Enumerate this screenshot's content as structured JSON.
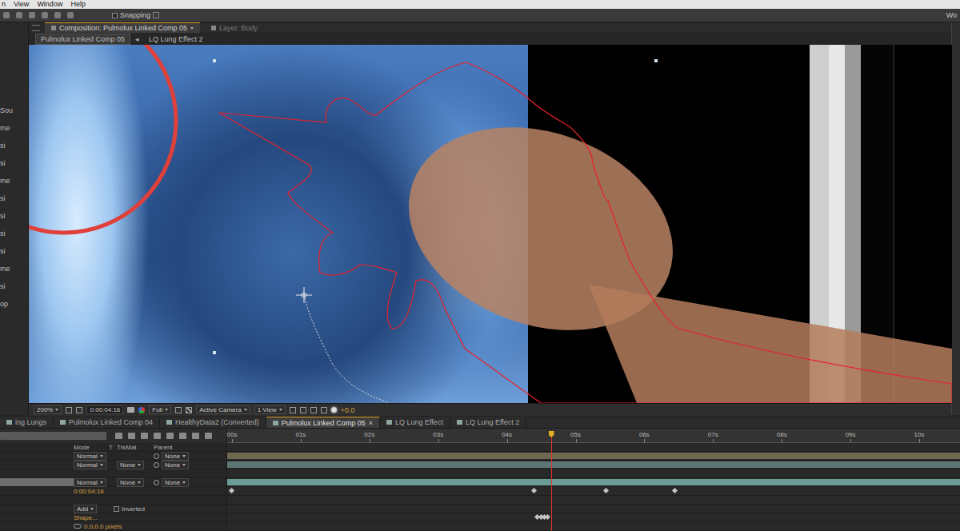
{
  "menu": [
    {
      "label": "n"
    },
    {
      "label": "View"
    },
    {
      "label": "Window"
    },
    {
      "label": "Help"
    }
  ],
  "toolbar": {
    "snapping": {
      "label": "Snapping",
      "checked": false
    },
    "workspace": "Wo"
  },
  "left_panel": {
    "items": [
      "Sou",
      "me",
      "si",
      "si",
      "me",
      "si",
      "si",
      "si",
      "si",
      "me",
      "si",
      "op"
    ]
  },
  "composition_panel": {
    "tabs": [
      {
        "label": "Composition: Pulmolux Linked Comp 05",
        "selected": true
      },
      {
        "label": "Layer: Body",
        "selected": false
      }
    ],
    "breadcrumbs": [
      {
        "label": "Pulmolux Linked Comp 05",
        "selected": true
      },
      {
        "label": "LQ Lung Effect 2",
        "selected": false
      }
    ],
    "separator": "◂"
  },
  "viewer_controls": {
    "zoom": "200%",
    "time": "0:00:04:16",
    "resolution": "Full",
    "camera": "Active Camera",
    "views": "1 View",
    "exposure": "+0.0"
  },
  "timeline": {
    "tabs": [
      {
        "label": "ing Lungs",
        "selected": false
      },
      {
        "label": "Pulmolux Linked Comp 04",
        "selected": false
      },
      {
        "label": "HealthyData2 (Converted)",
        "selected": false
      },
      {
        "label": "Pulmolux Linked Comp 05",
        "selected": true
      },
      {
        "label": "LQ Lung Effect",
        "selected": false
      },
      {
        "label": "LQ Lung Effect 2",
        "selected": false
      }
    ],
    "close": "×",
    "ruler": {
      "labels": [
        "00s",
        "01s",
        "02s",
        "03s",
        "04s",
        "05s",
        "06s",
        "07s",
        "08s",
        "09s",
        "10s"
      ]
    },
    "playhead": {
      "level": 0.464
    },
    "columns": [
      "Mode",
      "T",
      "TrkMat",
      "Parent"
    ],
    "layers": [
      {
        "mode": "Normal",
        "parent": "None",
        "selected": false,
        "color": "#6e6a52"
      },
      {
        "mode": "Normal",
        "trkmat": "None",
        "parent": "None",
        "selected": false,
        "color": "#5c7674"
      },
      {
        "mode": "Normal",
        "trkmat": "None",
        "parent": "None",
        "selected": true,
        "color": "#6a9c96",
        "keyframes": [
          0.0,
          4.4,
          5.45,
          6.45
        ]
      }
    ],
    "time_property": "0:00:04:16",
    "mask": {
      "mode": "Add",
      "inverted": {
        "label": "Inverted",
        "checked": false
      },
      "shape": "Shape...",
      "shape_keyframes": [
        4.45,
        4.5,
        4.55,
        4.6
      ],
      "feather": "0.0,0.0 pixels"
    }
  }
}
